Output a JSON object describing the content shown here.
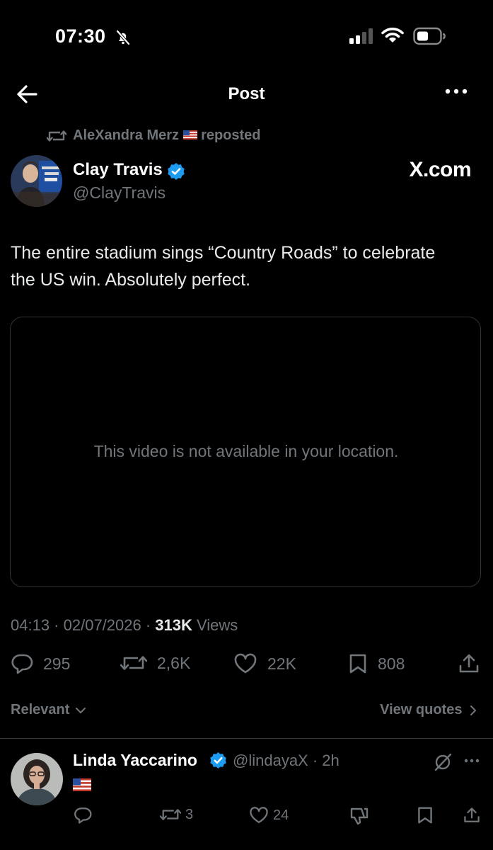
{
  "status_bar": {
    "time": "07:30"
  },
  "nav": {
    "title": "Post"
  },
  "repost": {
    "user": "AleXandra Merz",
    "action": "reposted"
  },
  "author": {
    "name": "Clay Travis",
    "handle": "@ClayTravis",
    "source": "X.com"
  },
  "tweet": {
    "text": "The entire stadium sings “Country Roads” to celebrate the US win. Absolutely perfect.",
    "media_message": "This video is not available in your location."
  },
  "meta": {
    "time": "04:13",
    "date": "02/07/2026",
    "views_count": "313K",
    "views_label": "Views"
  },
  "actions": {
    "replies": "295",
    "reposts": "2,6K",
    "likes": "22K",
    "bookmarks": "808"
  },
  "sort": {
    "label": "Relevant",
    "view_quotes": "View quotes"
  },
  "reply": {
    "name": "Linda Yaccarino",
    "handle": "@lindayaX",
    "time": "2h",
    "reposts": "3",
    "likes": "24"
  },
  "colors": {
    "background": "#000000",
    "muted": "#71767b",
    "verified": "#1d9bf0",
    "divider": "#2f3336"
  }
}
